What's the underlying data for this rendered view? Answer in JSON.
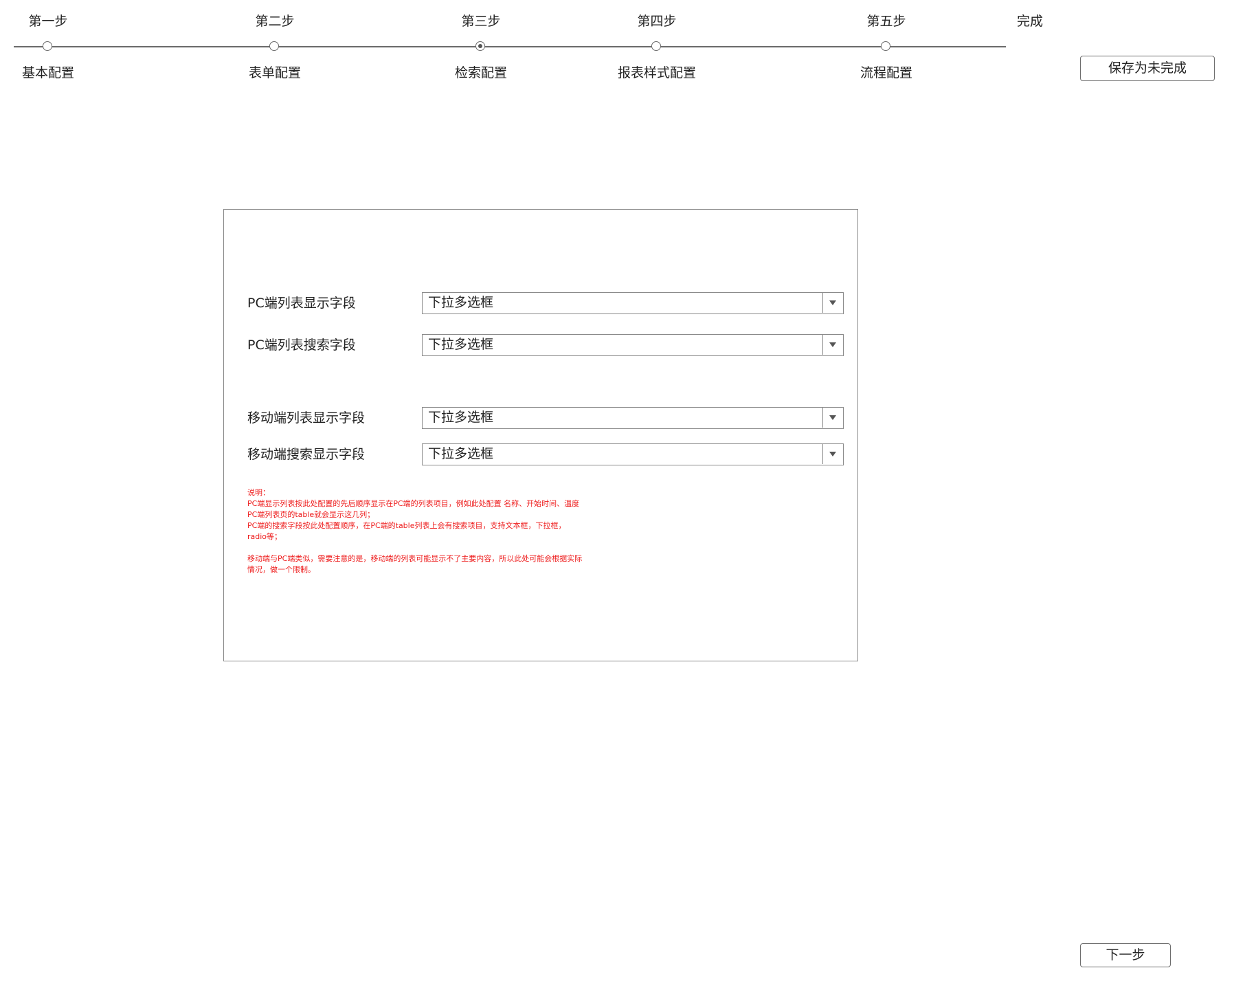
{
  "stepper": {
    "steps": [
      {
        "title": "第一步",
        "label": "基本配置",
        "active": false
      },
      {
        "title": "第二步",
        "label": "表单配置",
        "active": false
      },
      {
        "title": "第三步",
        "label": "检索配置",
        "active": true
      },
      {
        "title": "第四步",
        "label": "报表样式配置",
        "active": false
      },
      {
        "title": "第五步",
        "label": "流程配置",
        "active": false
      }
    ],
    "finish_label": "完成"
  },
  "actions": {
    "save_label": "保存为未完成",
    "next_label": "下一步"
  },
  "form": {
    "fields": [
      {
        "label": "PC端列表显示字段",
        "value": "下拉多选框"
      },
      {
        "label": "PC端列表搜索字段",
        "value": "下拉多选框"
      },
      {
        "label": "移动端列表显示字段",
        "value": "下拉多选框"
      },
      {
        "label": "移动端搜索显示字段",
        "value": "下拉多选框"
      }
    ],
    "note": "说明：\nPC端显示列表按此处配置的先后顺序显示在PC端的列表项目，例如此处配置 名称、开始时间、温度   PC端列表页的table就会显示这几列；\nPC端的搜索字段按此处配置顺序，在PC端的table列表上会有搜索项目，支持文本框，下拉框，radio等；\n\n移动端与PC端类似，需要注意的是，移动端的列表可能显示不了主要内容，所以此处可能会根据实际情况，做一个限制。"
  },
  "colors": {
    "line": "#6b6b6b",
    "border": "#8a8a8a",
    "note_text": "#ee1c1c"
  }
}
